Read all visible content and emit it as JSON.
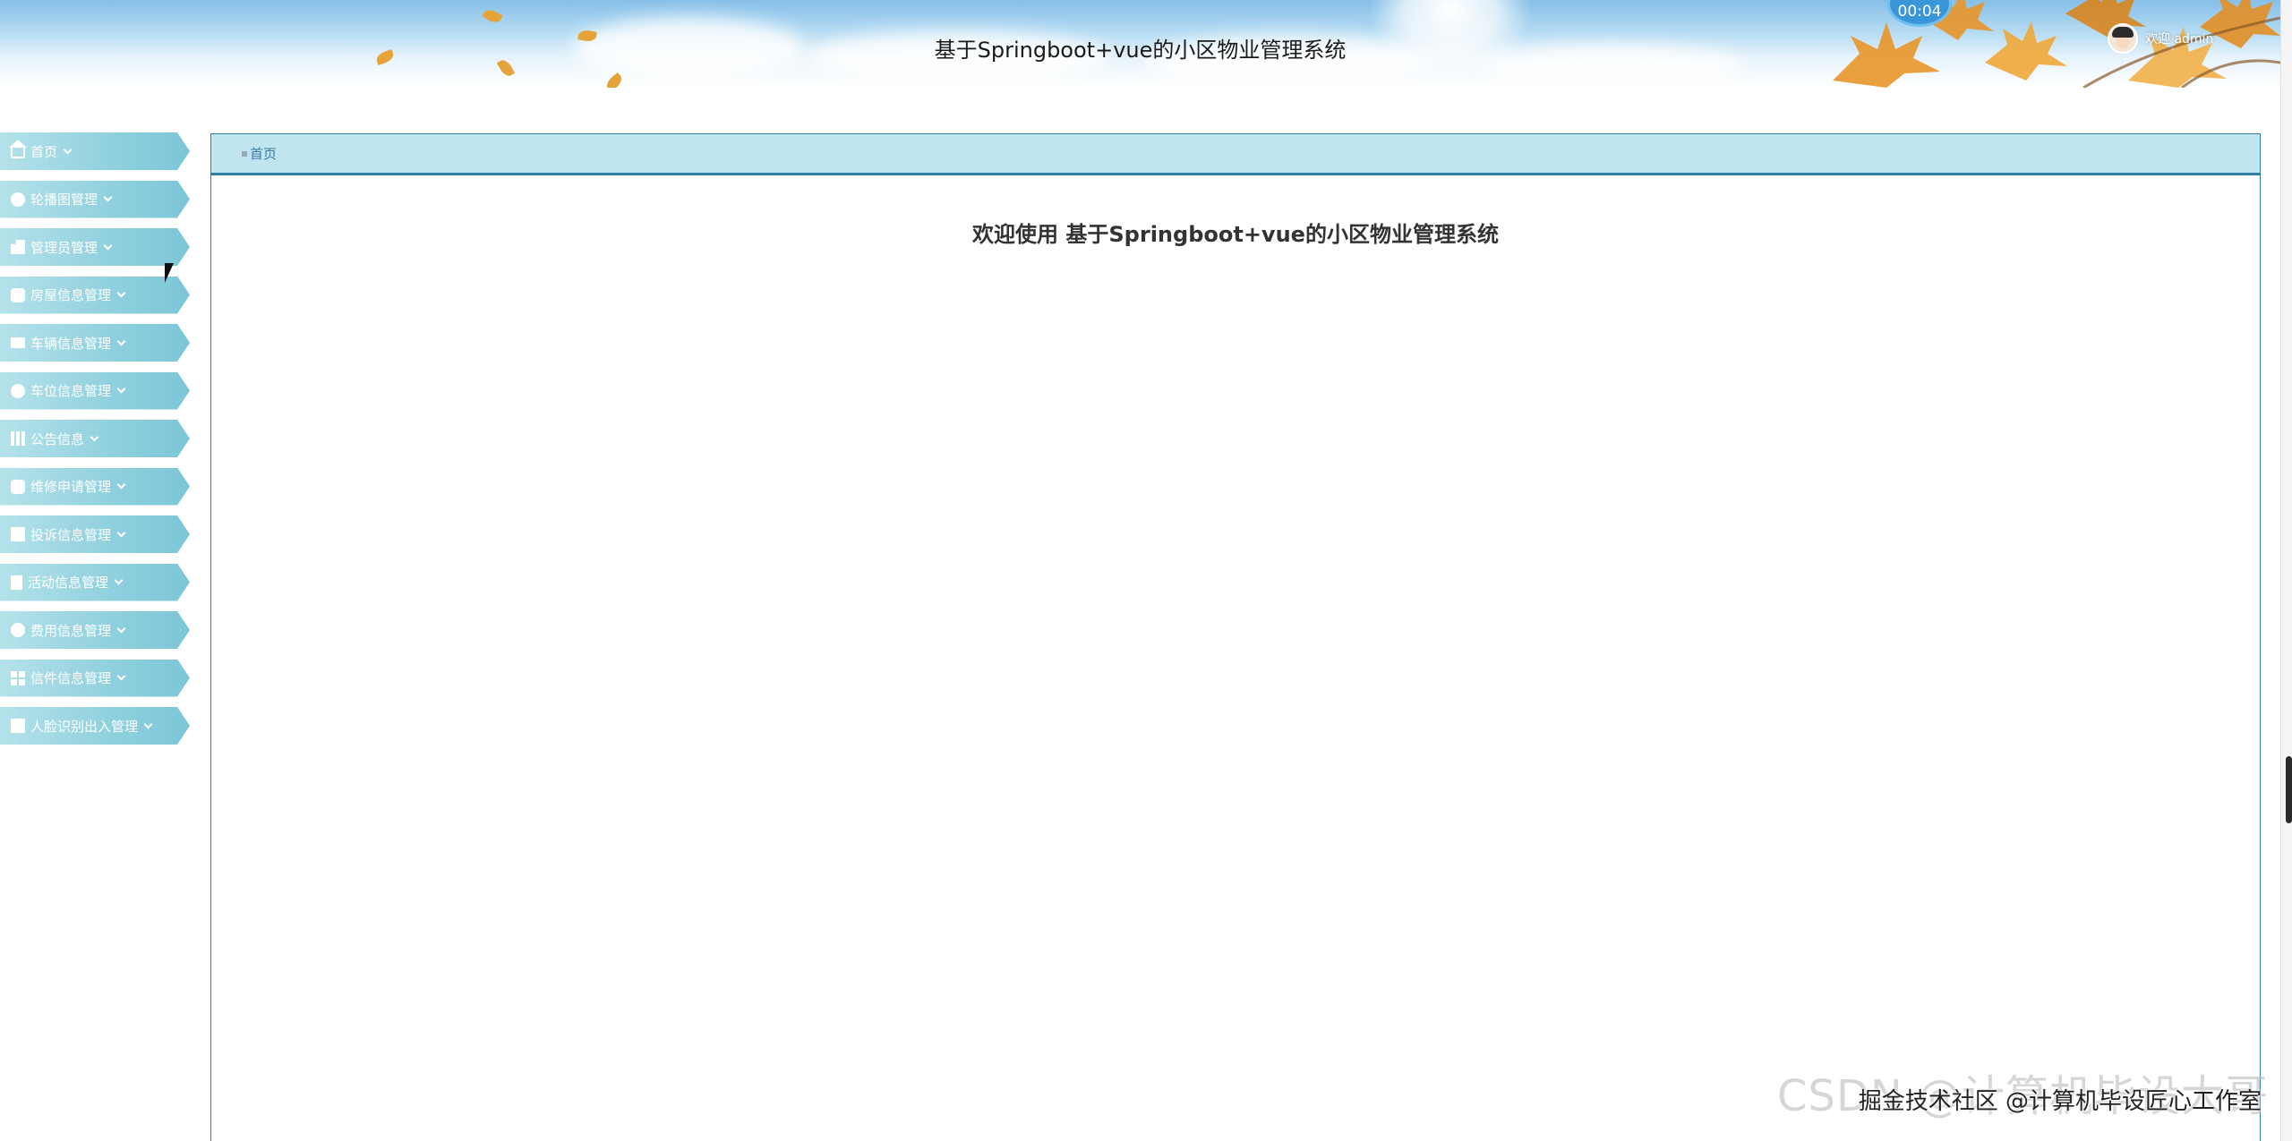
{
  "header": {
    "title": "基于Springboot+vue的小区物业管理系统",
    "timer": "00:04",
    "welcome": "欢迎 admin"
  },
  "sidebar": {
    "items": [
      {
        "label": "首页",
        "icon": "home-icon"
      },
      {
        "label": "轮播图管理",
        "icon": "circle-icon"
      },
      {
        "label": "管理员管理",
        "icon": "building-icon"
      },
      {
        "label": "房屋信息管理",
        "icon": "database-icon"
      },
      {
        "label": "车辆信息管理",
        "icon": "card-icon"
      },
      {
        "label": "车位信息管理",
        "icon": "circle-icon"
      },
      {
        "label": "公告信息",
        "icon": "columns-icon"
      },
      {
        "label": "维修申请管理",
        "icon": "shop-icon"
      },
      {
        "label": "投诉信息管理",
        "icon": "message-icon"
      },
      {
        "label": "活动信息管理",
        "icon": "document-icon"
      },
      {
        "label": "费用信息管理",
        "icon": "coin-icon"
      },
      {
        "label": "信件信息管理",
        "icon": "grid-icon"
      },
      {
        "label": "人脸识别出入管理",
        "icon": "table-icon"
      }
    ]
  },
  "breadcrumb": {
    "current": "首页"
  },
  "main": {
    "welcome_heading": "欢迎使用 基于Springboot+vue的小区物业管理系统"
  },
  "watermark": {
    "text": "CSDN @计算机毕设大哥",
    "overlay": "掘金技术社区 @计算机毕设匠心工作室"
  }
}
